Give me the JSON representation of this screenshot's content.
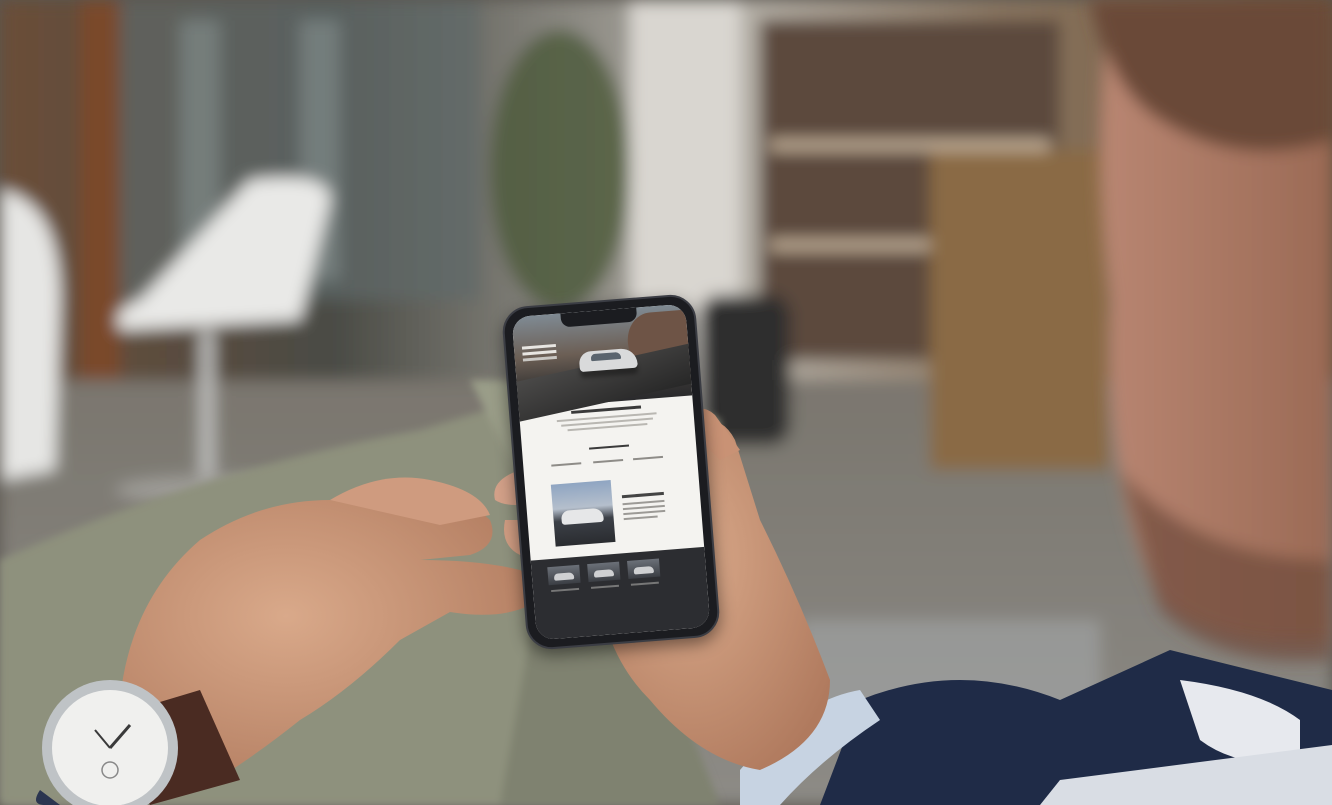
{
  "scene": {
    "description": "",
    "colors": {
      "background": "#5a5650",
      "phone_frame": "#1b1c20",
      "screen": "#f4f3f0",
      "jacket": "#1f2b47",
      "pants": "#8e917d"
    }
  },
  "phone_screen": {
    "sections": [
      "hero-image",
      "headline",
      "features",
      "car-feature",
      "model-gallery"
    ],
    "gallery_count": 3
  }
}
